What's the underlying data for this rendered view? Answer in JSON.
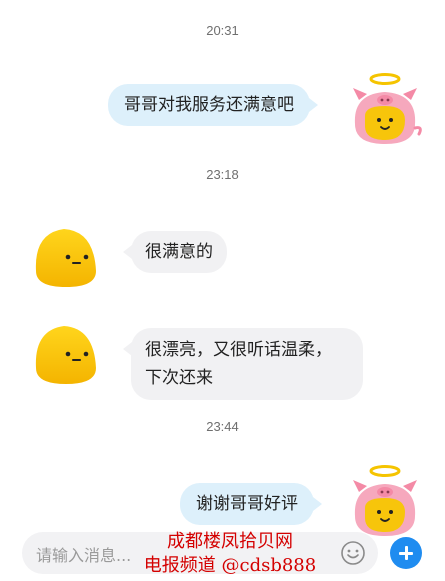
{
  "messages": [
    {
      "time": "20:31",
      "sender": "me",
      "text": "哥哥对我服务还满意吧"
    },
    {
      "time": "23:18",
      "sender": "other",
      "text": "很满意的"
    },
    {
      "sender": "other",
      "text_lines": [
        "很漂亮，又很听话温柔，",
        "下次还来"
      ]
    },
    {
      "time": "23:44",
      "sender": "me",
      "text": "谢谢哥哥好评"
    }
  ],
  "input": {
    "placeholder": "请输入消息..."
  },
  "watermark": {
    "line1": "成都楼凤拾贝网",
    "line2": "电报频道 @cdsb888"
  },
  "colors": {
    "outgoing_bubble": "#ddf0fb",
    "incoming_bubble": "#f1f1f3",
    "plus_button": "#1f8cf0",
    "watermark": "#d40000"
  },
  "icons": [
    "pig-angel-avatar-icon",
    "yellow-blob-avatar-icon",
    "emoji-icon",
    "plus-icon"
  ]
}
